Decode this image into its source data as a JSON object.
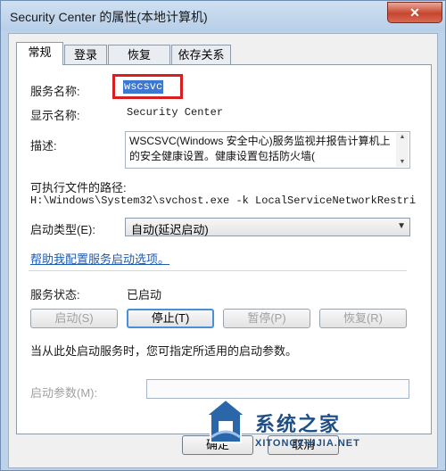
{
  "window": {
    "title": "Security Center 的属性(本地计算机)",
    "close_glyph": "✕"
  },
  "tabs": [
    {
      "label": "常规",
      "active": true
    },
    {
      "label": "登录",
      "active": false
    },
    {
      "label": "恢复",
      "active": false
    },
    {
      "label": "依存关系",
      "active": false
    }
  ],
  "general": {
    "service_name_label": "服务名称:",
    "service_name_value": "wscsvc",
    "display_name_label": "显示名称:",
    "display_name_value": "Security Center",
    "description_label": "描述:",
    "description_value": "WSCSVC(Windows 安全中心)服务监视并报告计算机上的安全健康设置。健康设置包括防火墙(",
    "exe_path_label": "可执行文件的路径:",
    "exe_path_value": "H:\\Windows\\System32\\svchost.exe -k LocalServiceNetworkRestri",
    "startup_type_label": "启动类型(E):",
    "startup_type_value": "自动(延迟启动)",
    "help_link": "帮助我配置服务启动选项。",
    "status_label": "服务状态:",
    "status_value": "已启动",
    "start_params_note": "当从此处启动服务时，您可指定所适用的启动参数。",
    "start_params_label": "启动参数(M):",
    "start_params_value": ""
  },
  "buttons": {
    "start": "启动(S)",
    "stop": "停止(T)",
    "pause": "暂停(P)",
    "resume": "恢复(R)",
    "ok": "确定",
    "cancel": "取消"
  },
  "watermark": {
    "brand": "系统之家",
    "url": "XITONGZHIJIA.NET"
  },
  "colors": {
    "selection": "#3c78cf",
    "highlight_border": "#d71f1f",
    "link": "#1e5bb3",
    "brand": "#1e4f86"
  }
}
